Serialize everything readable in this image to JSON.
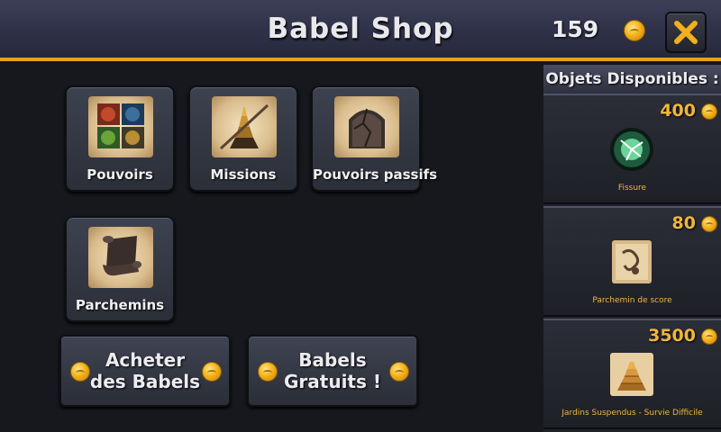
{
  "header": {
    "title": "Babel Shop",
    "coins": "159",
    "coin_icon": "gold-coin-icon",
    "close_icon": "close-x-icon",
    "accent_color": "#e3a31f"
  },
  "categories": [
    {
      "label": "Pouvoirs",
      "icon": "powers-icon"
    },
    {
      "label": "Missions",
      "icon": "missions-tower-icon"
    },
    {
      "label": "Pouvoirs passifs",
      "icon": "passive-powers-icon"
    },
    {
      "label": "Parchemins",
      "icon": "scroll-icon"
    }
  ],
  "actions": {
    "buy_babels": "Acheter\ndes Babels",
    "free_babels": "Babels\nGratuits !"
  },
  "panel": {
    "title": "Objets Disponibles :",
    "items": [
      {
        "price": "400",
        "name": "Fissure",
        "icon": "fissure-orb-icon"
      },
      {
        "price": "80",
        "name": "Parchemin de score",
        "icon": "score-scroll-icon"
      },
      {
        "price": "3500",
        "name": "Jardins Suspendus - Survie Difficile",
        "icon": "hanging-gardens-icon"
      }
    ]
  }
}
